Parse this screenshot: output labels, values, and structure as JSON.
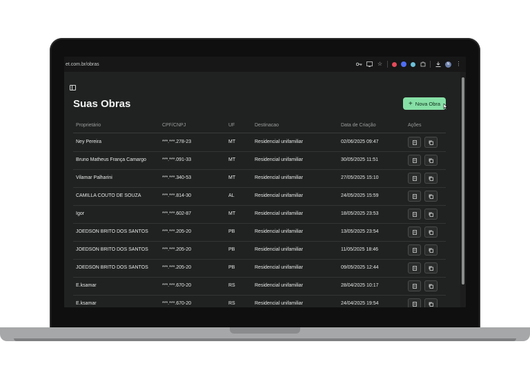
{
  "browser": {
    "url": "et.com.br/obras",
    "profile_initial": "N"
  },
  "header": {
    "title": "Suas Obras",
    "new_button_label": "Nova Obra"
  },
  "table": {
    "columns": [
      "Proprietário",
      "CPF/CNPJ",
      "UF",
      "Destinacao",
      "Data de Criação",
      "Ações"
    ],
    "rows": [
      {
        "owner": "Ney Pereira",
        "doc": "***.***.278-23",
        "uf": "MT",
        "dest": "Residencial unifamiliar",
        "date": "02/06/2025 09:47"
      },
      {
        "owner": "Bruno Matheus França Camargo",
        "doc": "***.***.091-33",
        "uf": "MT",
        "dest": "Residencial unifamiliar",
        "date": "30/05/2025 11:51"
      },
      {
        "owner": "Vilamar Palharini",
        "doc": "***.***.340-53",
        "uf": "MT",
        "dest": "Residencial unifamiliar",
        "date": "27/05/2025 15:10"
      },
      {
        "owner": "CAMILLA COUTO DE SOUZA",
        "doc": "***.***.814-30",
        "uf": "AL",
        "dest": "Residencial unifamiliar",
        "date": "24/05/2025 15:59"
      },
      {
        "owner": "Igor",
        "doc": "***.***.602-87",
        "uf": "MT",
        "dest": "Residencial unifamiliar",
        "date": "18/05/2025 23:53"
      },
      {
        "owner": "JOEDSON BRITO DOS SANTOS",
        "doc": "***.***.205-20",
        "uf": "PB",
        "dest": "Residencial unifamiliar",
        "date": "13/05/2025 23:54"
      },
      {
        "owner": "JOEDSON BRITO DOS SANTOS",
        "doc": "***.***.205-20",
        "uf": "PB",
        "dest": "Residencial unifamiliar",
        "date": "11/05/2025 18:46"
      },
      {
        "owner": "JOEDSON BRITO DOS SANTOS",
        "doc": "***.***.205-20",
        "uf": "PB",
        "dest": "Residencial unifamiliar",
        "date": "09/05/2025 12:44"
      },
      {
        "owner": "E.ksamar",
        "doc": "***.***.670-20",
        "uf": "RS",
        "dest": "Residencial unifamiliar",
        "date": "28/04/2025 10:17"
      },
      {
        "owner": "E.ksamar",
        "doc": "***.***.670-20",
        "uf": "RS",
        "dest": "Residencial unifamiliar",
        "date": "24/04/2025 19:54"
      }
    ]
  },
  "icons": {
    "sidebar_toggle": "sidebar-toggle-icon",
    "row_action_1": "document-icon",
    "row_action_2": "copy-icon"
  },
  "colors": {
    "accent": "#86e0a6",
    "background": "#202221"
  }
}
